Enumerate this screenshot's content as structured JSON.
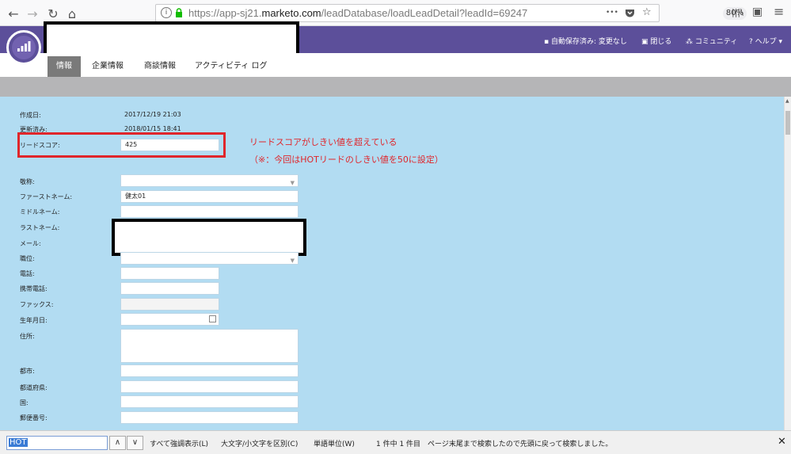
{
  "browser": {
    "back_icon": "←",
    "forward_icon": "→",
    "reload_icon": "↻",
    "home_icon": "⌂",
    "url_prefix": "https://app-sj21.",
    "url_domain": "marketo.com",
    "url_path": "/leadDatabase/loadLeadDetail?leadId=69247",
    "zoom": "80%",
    "more_icon": "•••",
    "library_icon": "|||\\",
    "sidebar_icon": "▣",
    "menu_icon": "≡"
  },
  "header": {
    "autosave": "自動保存済み: 変更なし",
    "close": "閉じる",
    "community": "コミュニティ",
    "help": "ヘルプ"
  },
  "tabs": [
    {
      "label": "情報"
    },
    {
      "label": "企業情報"
    },
    {
      "label": "商談情報"
    },
    {
      "label": "アクティビティ ログ"
    }
  ],
  "form": {
    "created_label": "作成日:",
    "created_value": "2017/12/19 21:03",
    "updated_label": "更新済み:",
    "updated_value": "2018/01/15 18:41",
    "score_label": "リードスコア:",
    "score_value": "425",
    "salutation_label": "敬称:",
    "firstname_label": "ファーストネーム:",
    "firstname_value": "健太01",
    "middlename_label": "ミドルネーム:",
    "lastname_label": "ラストネーム:",
    "email_label": "メール:",
    "title_label": "職位:",
    "phone_label": "電話:",
    "mobile_label": "携帯電話:",
    "fax_label": "ファックス:",
    "birthday_label": "生年月日:",
    "address_label": "住所:",
    "city_label": "都市:",
    "state_label": "都道府県:",
    "country_label": "国:",
    "postal_label": "郵便番号:"
  },
  "annotation": {
    "line1": "リードスコアがしきい値を超えている",
    "line2": "（※：今回はHOTリードのしきい値を50に設定）",
    "color": "#e0262b"
  },
  "findbar": {
    "query": "HOT",
    "prev_icon": "∧",
    "next_icon": "∨",
    "highlight_all": "すべて強調表示(L)",
    "match_case": "大文字/小文字を区別(C)",
    "whole_words": "単語単位(W)",
    "status": "1 件中 1 件目　ページ末尾まで検索したので先頭に戻って検索しました。",
    "close_icon": "✕"
  },
  "colors": {
    "brand_purple": "#5c4f9a",
    "form_background": "#b2dcf2"
  }
}
